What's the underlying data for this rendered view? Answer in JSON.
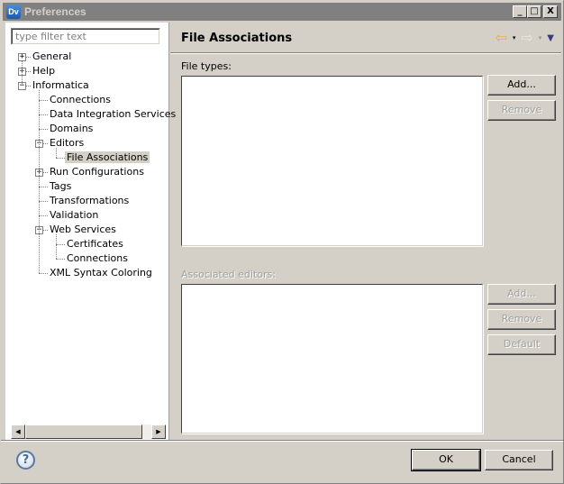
{
  "window": {
    "title": "Preferences",
    "app_icon_text": "Dv",
    "controls": {
      "minimize": "_",
      "maximize": "□",
      "close": "X"
    }
  },
  "filter": {
    "placeholder": "type filter text",
    "value": ""
  },
  "tree": [
    {
      "label": "General",
      "level": 0,
      "toggle": "+",
      "selected": false
    },
    {
      "label": "Help",
      "level": 0,
      "toggle": "+",
      "selected": false
    },
    {
      "label": "Informatica",
      "level": 0,
      "toggle": "-",
      "selected": false
    },
    {
      "label": "Connections",
      "level": 1,
      "toggle": null,
      "selected": false
    },
    {
      "label": "Data Integration Services",
      "level": 1,
      "toggle": null,
      "selected": false
    },
    {
      "label": "Domains",
      "level": 1,
      "toggle": null,
      "selected": false
    },
    {
      "label": "Editors",
      "level": 1,
      "toggle": "-",
      "selected": false
    },
    {
      "label": "File Associations",
      "level": 2,
      "toggle": null,
      "selected": true
    },
    {
      "label": "Run Configurations",
      "level": 1,
      "toggle": "+",
      "selected": false
    },
    {
      "label": "Tags",
      "level": 1,
      "toggle": null,
      "selected": false
    },
    {
      "label": "Transformations",
      "level": 1,
      "toggle": null,
      "selected": false
    },
    {
      "label": "Validation",
      "level": 1,
      "toggle": null,
      "selected": false
    },
    {
      "label": "Web Services",
      "level": 1,
      "toggle": "-",
      "selected": false
    },
    {
      "label": "Certificates",
      "level": 2,
      "toggle": null,
      "selected": false
    },
    {
      "label": "Connections",
      "level": 2,
      "toggle": null,
      "selected": false
    },
    {
      "label": "XML Syntax Coloring",
      "level": 1,
      "toggle": null,
      "selected": false
    }
  ],
  "page": {
    "title": "File Associations",
    "nav": {
      "back": "⇦",
      "forward": "⇨",
      "dropdown": "▾",
      "menu": "▼"
    },
    "file_types": {
      "label": "File types:",
      "items": [],
      "buttons": {
        "add": "Add...",
        "remove": "Remove"
      }
    },
    "associated_editors": {
      "label": "Associated editors:",
      "items": [],
      "buttons": {
        "add": "Add...",
        "remove": "Remove",
        "default": "Default"
      }
    }
  },
  "scrollbar": {
    "left": "◀",
    "right": "▶"
  },
  "footer": {
    "help": "?",
    "ok": "OK",
    "cancel": "Cancel"
  }
}
